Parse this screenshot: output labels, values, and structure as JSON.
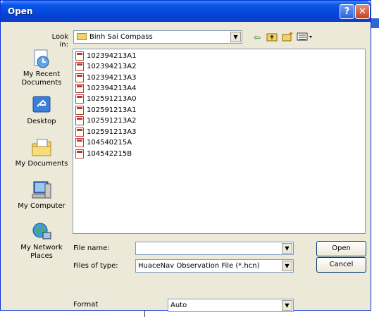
{
  "window": {
    "title": "Open",
    "help_glyph": "?",
    "close_glyph": "✕"
  },
  "toolbar": {
    "look_in_label": "Look in:",
    "look_in_value": "Binh Sai Compass",
    "icons": [
      "back-arrow-icon",
      "up-folder-icon",
      "new-folder-icon",
      "view-menu-icon"
    ]
  },
  "places": [
    {
      "label": "My Recent\nDocuments",
      "icon": "recent-documents-icon"
    },
    {
      "label": "Desktop",
      "icon": "desktop-icon"
    },
    {
      "label": "My Documents",
      "icon": "my-documents-icon"
    },
    {
      "label": "My Computer",
      "icon": "my-computer-icon"
    },
    {
      "label": "My Network\nPlaces",
      "icon": "network-places-icon"
    }
  ],
  "files": [
    "102394213A1",
    "102394213A2",
    "102394213A3",
    "102394213A4",
    "102591213A0",
    "102591213A1",
    "102591213A2",
    "102591213A3",
    "104540215A",
    "104542215B"
  ],
  "form": {
    "file_name_label": "File name:",
    "file_name_value": "",
    "file_type_label": "Files of type:",
    "file_type_value": "HuaceNav Observation File (*.hcn)",
    "format_label": "Format",
    "format_value": "Auto"
  },
  "buttons": {
    "open": "Open",
    "cancel": "Cancel"
  },
  "colors": {
    "titlebar": "#0a56e8",
    "dialog_bg": "#ece9d8",
    "close": "#c3441f"
  }
}
